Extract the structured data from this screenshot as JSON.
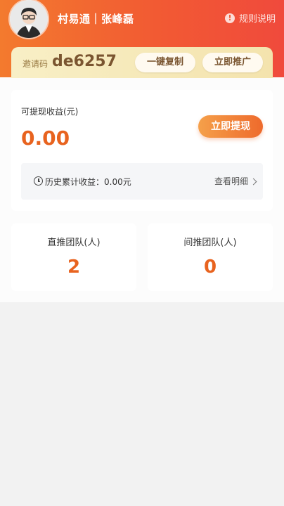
{
  "header": {
    "user_name": "村易通｜张峰磊",
    "rules_label": "规则说明",
    "rules_icon": "info-icon"
  },
  "invite": {
    "label": "邀请码",
    "code": "de6257",
    "copy_label": "一键复制",
    "promote_label": "立即推广"
  },
  "earnings": {
    "label": "可提现收益(元)",
    "amount": "0.00",
    "withdraw_label": "立即提现",
    "history_text": "历史累计收益：0.00元",
    "detail_label": "查看明细"
  },
  "teams": {
    "direct_label": "直推团队(人)",
    "direct_count": "2",
    "indirect_label": "间推团队(人)",
    "indirect_count": "0"
  },
  "colors": {
    "header_gradient_start": "#f37a2e",
    "header_gradient_end": "#f04a3c",
    "accent": "#e8631f",
    "invite_bg": "#f8efc6"
  }
}
